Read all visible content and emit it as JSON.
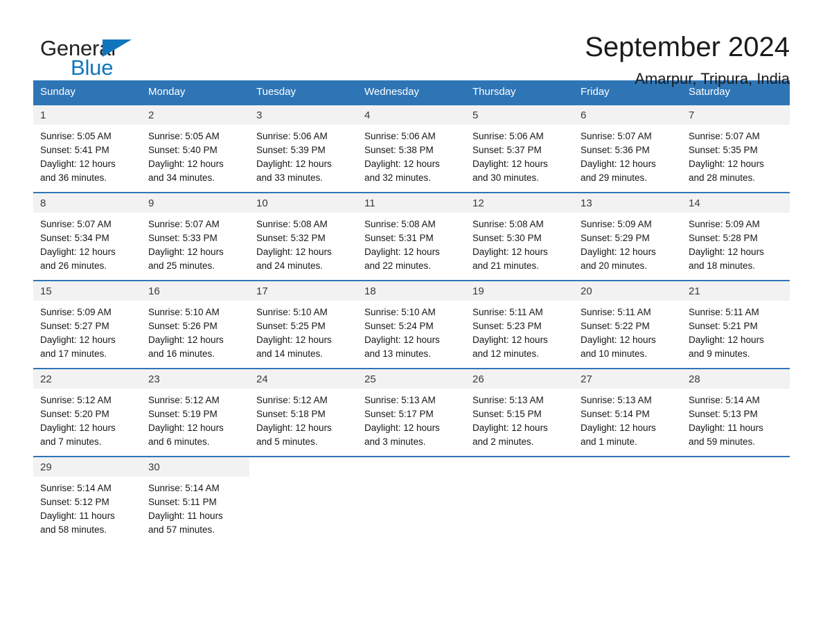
{
  "brand": {
    "name_part1": "General",
    "name_part2": "Blue",
    "accent_color": "#0f76bc"
  },
  "header": {
    "month_year": "September 2024",
    "location": "Amarpur, Tripura, India"
  },
  "theme": {
    "header_band": "#2e75b6",
    "daynum_band": "#f2f2f2",
    "text": "#161616"
  },
  "weekday_headers": [
    "Sunday",
    "Monday",
    "Tuesday",
    "Wednesday",
    "Thursday",
    "Friday",
    "Saturday"
  ],
  "weeks": [
    [
      {
        "day": "1",
        "sunrise": "Sunrise: 5:05 AM",
        "sunset": "Sunset: 5:41 PM",
        "daylight_line1": "Daylight: 12 hours",
        "daylight_line2": "and 36 minutes."
      },
      {
        "day": "2",
        "sunrise": "Sunrise: 5:05 AM",
        "sunset": "Sunset: 5:40 PM",
        "daylight_line1": "Daylight: 12 hours",
        "daylight_line2": "and 34 minutes."
      },
      {
        "day": "3",
        "sunrise": "Sunrise: 5:06 AM",
        "sunset": "Sunset: 5:39 PM",
        "daylight_line1": "Daylight: 12 hours",
        "daylight_line2": "and 33 minutes."
      },
      {
        "day": "4",
        "sunrise": "Sunrise: 5:06 AM",
        "sunset": "Sunset: 5:38 PM",
        "daylight_line1": "Daylight: 12 hours",
        "daylight_line2": "and 32 minutes."
      },
      {
        "day": "5",
        "sunrise": "Sunrise: 5:06 AM",
        "sunset": "Sunset: 5:37 PM",
        "daylight_line1": "Daylight: 12 hours",
        "daylight_line2": "and 30 minutes."
      },
      {
        "day": "6",
        "sunrise": "Sunrise: 5:07 AM",
        "sunset": "Sunset: 5:36 PM",
        "daylight_line1": "Daylight: 12 hours",
        "daylight_line2": "and 29 minutes."
      },
      {
        "day": "7",
        "sunrise": "Sunrise: 5:07 AM",
        "sunset": "Sunset: 5:35 PM",
        "daylight_line1": "Daylight: 12 hours",
        "daylight_line2": "and 28 minutes."
      }
    ],
    [
      {
        "day": "8",
        "sunrise": "Sunrise: 5:07 AM",
        "sunset": "Sunset: 5:34 PM",
        "daylight_line1": "Daylight: 12 hours",
        "daylight_line2": "and 26 minutes."
      },
      {
        "day": "9",
        "sunrise": "Sunrise: 5:07 AM",
        "sunset": "Sunset: 5:33 PM",
        "daylight_line1": "Daylight: 12 hours",
        "daylight_line2": "and 25 minutes."
      },
      {
        "day": "10",
        "sunrise": "Sunrise: 5:08 AM",
        "sunset": "Sunset: 5:32 PM",
        "daylight_line1": "Daylight: 12 hours",
        "daylight_line2": "and 24 minutes."
      },
      {
        "day": "11",
        "sunrise": "Sunrise: 5:08 AM",
        "sunset": "Sunset: 5:31 PM",
        "daylight_line1": "Daylight: 12 hours",
        "daylight_line2": "and 22 minutes."
      },
      {
        "day": "12",
        "sunrise": "Sunrise: 5:08 AM",
        "sunset": "Sunset: 5:30 PM",
        "daylight_line1": "Daylight: 12 hours",
        "daylight_line2": "and 21 minutes."
      },
      {
        "day": "13",
        "sunrise": "Sunrise: 5:09 AM",
        "sunset": "Sunset: 5:29 PM",
        "daylight_line1": "Daylight: 12 hours",
        "daylight_line2": "and 20 minutes."
      },
      {
        "day": "14",
        "sunrise": "Sunrise: 5:09 AM",
        "sunset": "Sunset: 5:28 PM",
        "daylight_line1": "Daylight: 12 hours",
        "daylight_line2": "and 18 minutes."
      }
    ],
    [
      {
        "day": "15",
        "sunrise": "Sunrise: 5:09 AM",
        "sunset": "Sunset: 5:27 PM",
        "daylight_line1": "Daylight: 12 hours",
        "daylight_line2": "and 17 minutes."
      },
      {
        "day": "16",
        "sunrise": "Sunrise: 5:10 AM",
        "sunset": "Sunset: 5:26 PM",
        "daylight_line1": "Daylight: 12 hours",
        "daylight_line2": "and 16 minutes."
      },
      {
        "day": "17",
        "sunrise": "Sunrise: 5:10 AM",
        "sunset": "Sunset: 5:25 PM",
        "daylight_line1": "Daylight: 12 hours",
        "daylight_line2": "and 14 minutes."
      },
      {
        "day": "18",
        "sunrise": "Sunrise: 5:10 AM",
        "sunset": "Sunset: 5:24 PM",
        "daylight_line1": "Daylight: 12 hours",
        "daylight_line2": "and 13 minutes."
      },
      {
        "day": "19",
        "sunrise": "Sunrise: 5:11 AM",
        "sunset": "Sunset: 5:23 PM",
        "daylight_line1": "Daylight: 12 hours",
        "daylight_line2": "and 12 minutes."
      },
      {
        "day": "20",
        "sunrise": "Sunrise: 5:11 AM",
        "sunset": "Sunset: 5:22 PM",
        "daylight_line1": "Daylight: 12 hours",
        "daylight_line2": "and 10 minutes."
      },
      {
        "day": "21",
        "sunrise": "Sunrise: 5:11 AM",
        "sunset": "Sunset: 5:21 PM",
        "daylight_line1": "Daylight: 12 hours",
        "daylight_line2": "and 9 minutes."
      }
    ],
    [
      {
        "day": "22",
        "sunrise": "Sunrise: 5:12 AM",
        "sunset": "Sunset: 5:20 PM",
        "daylight_line1": "Daylight: 12 hours",
        "daylight_line2": "and 7 minutes."
      },
      {
        "day": "23",
        "sunrise": "Sunrise: 5:12 AM",
        "sunset": "Sunset: 5:19 PM",
        "daylight_line1": "Daylight: 12 hours",
        "daylight_line2": "and 6 minutes."
      },
      {
        "day": "24",
        "sunrise": "Sunrise: 5:12 AM",
        "sunset": "Sunset: 5:18 PM",
        "daylight_line1": "Daylight: 12 hours",
        "daylight_line2": "and 5 minutes."
      },
      {
        "day": "25",
        "sunrise": "Sunrise: 5:13 AM",
        "sunset": "Sunset: 5:17 PM",
        "daylight_line1": "Daylight: 12 hours",
        "daylight_line2": "and 3 minutes."
      },
      {
        "day": "26",
        "sunrise": "Sunrise: 5:13 AM",
        "sunset": "Sunset: 5:15 PM",
        "daylight_line1": "Daylight: 12 hours",
        "daylight_line2": "and 2 minutes."
      },
      {
        "day": "27",
        "sunrise": "Sunrise: 5:13 AM",
        "sunset": "Sunset: 5:14 PM",
        "daylight_line1": "Daylight: 12 hours",
        "daylight_line2": "and 1 minute."
      },
      {
        "day": "28",
        "sunrise": "Sunrise: 5:14 AM",
        "sunset": "Sunset: 5:13 PM",
        "daylight_line1": "Daylight: 11 hours",
        "daylight_line2": "and 59 minutes."
      }
    ],
    [
      {
        "day": "29",
        "sunrise": "Sunrise: 5:14 AM",
        "sunset": "Sunset: 5:12 PM",
        "daylight_line1": "Daylight: 11 hours",
        "daylight_line2": "and 58 minutes."
      },
      {
        "day": "30",
        "sunrise": "Sunrise: 5:14 AM",
        "sunset": "Sunset: 5:11 PM",
        "daylight_line1": "Daylight: 11 hours",
        "daylight_line2": "and 57 minutes."
      },
      {
        "day": "",
        "sunrise": "",
        "sunset": "",
        "daylight_line1": "",
        "daylight_line2": ""
      },
      {
        "day": "",
        "sunrise": "",
        "sunset": "",
        "daylight_line1": "",
        "daylight_line2": ""
      },
      {
        "day": "",
        "sunrise": "",
        "sunset": "",
        "daylight_line1": "",
        "daylight_line2": ""
      },
      {
        "day": "",
        "sunrise": "",
        "sunset": "",
        "daylight_line1": "",
        "daylight_line2": ""
      },
      {
        "day": "",
        "sunrise": "",
        "sunset": "",
        "daylight_line1": "",
        "daylight_line2": ""
      }
    ]
  ]
}
